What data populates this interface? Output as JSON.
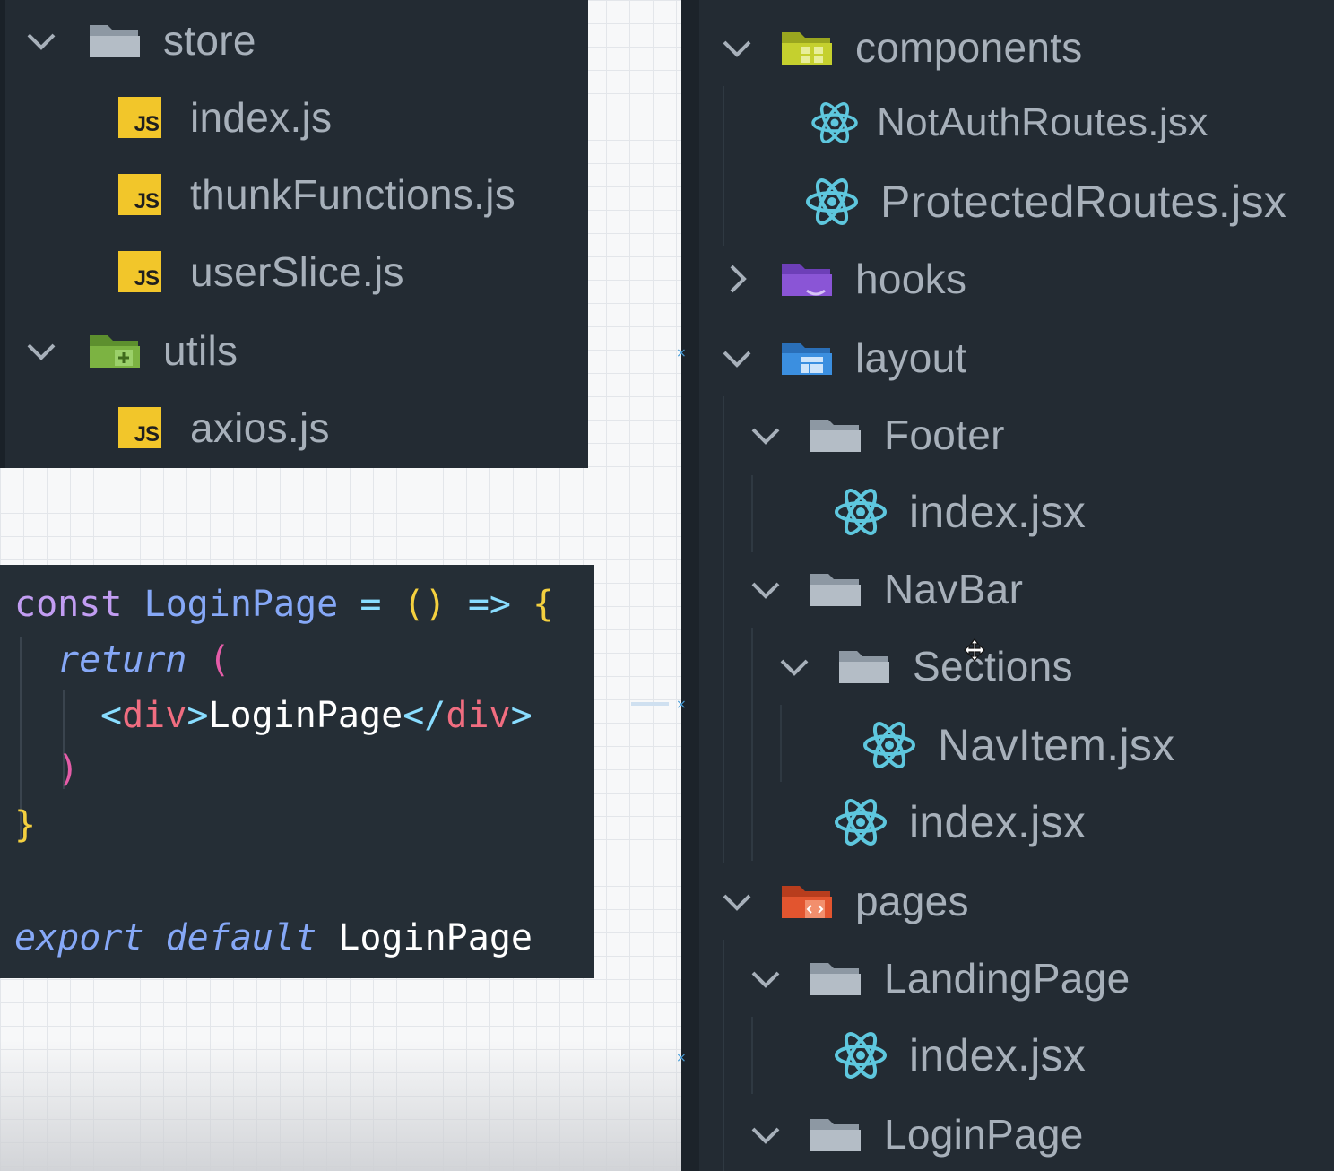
{
  "store_tree": {
    "store_folder": "store",
    "store_files": [
      "index.js",
      "thunkFunctions.js",
      "userSlice.js"
    ],
    "utils_folder": "utils",
    "utils_files": [
      "axios.js"
    ],
    "js_badge": "JS"
  },
  "code": {
    "line1": {
      "kw": "const",
      "name": "LoginPage",
      "eq": "=",
      "parens": "()",
      "arrow": "=>",
      "brace": "{"
    },
    "line2": {
      "kw": "return",
      "paren": "("
    },
    "line3": {
      "open_lt": "<",
      "open_tag": "div",
      "open_gt": ">",
      "text": "LoginPage",
      "close_lt": "</",
      "close_tag": "div",
      "close_gt": ">"
    },
    "line4": {
      "paren": ")"
    },
    "line5": {
      "brace": "}"
    },
    "line7": {
      "kw1": "export",
      "kw2": "default",
      "name": "LoginPage"
    }
  },
  "project_tree": {
    "components": "components",
    "not_auth_routes": "NotAuthRoutes.jsx",
    "protected_routes": "ProtectedRoutes.jsx",
    "hooks": "hooks",
    "layout": "layout",
    "footer": "Footer",
    "footer_index": "index.jsx",
    "navbar": "NavBar",
    "sections": "Sections",
    "navitem": "NavItem.jsx",
    "navbar_index": "index.jsx",
    "pages": "pages",
    "landing_page": "LandingPage",
    "landing_index": "index.jsx",
    "login_page": "LoginPage"
  },
  "icons": {
    "chevron_down": "chevron-down-icon",
    "chevron_right": "chevron-right-icon",
    "folder": "folder-icon",
    "react": "react-icon",
    "js": "js-file-icon"
  },
  "colors": {
    "panel_bg": "#232b33",
    "text": "#a7b0ba",
    "js_badge": "#f2c62a",
    "react": "#5ec7de",
    "components_folder": "#b9c42a",
    "hooks_folder": "#8a55d6",
    "layout_folder": "#3b8fe0",
    "pages_folder": "#e2552f",
    "utils_folder": "#7cb342"
  }
}
